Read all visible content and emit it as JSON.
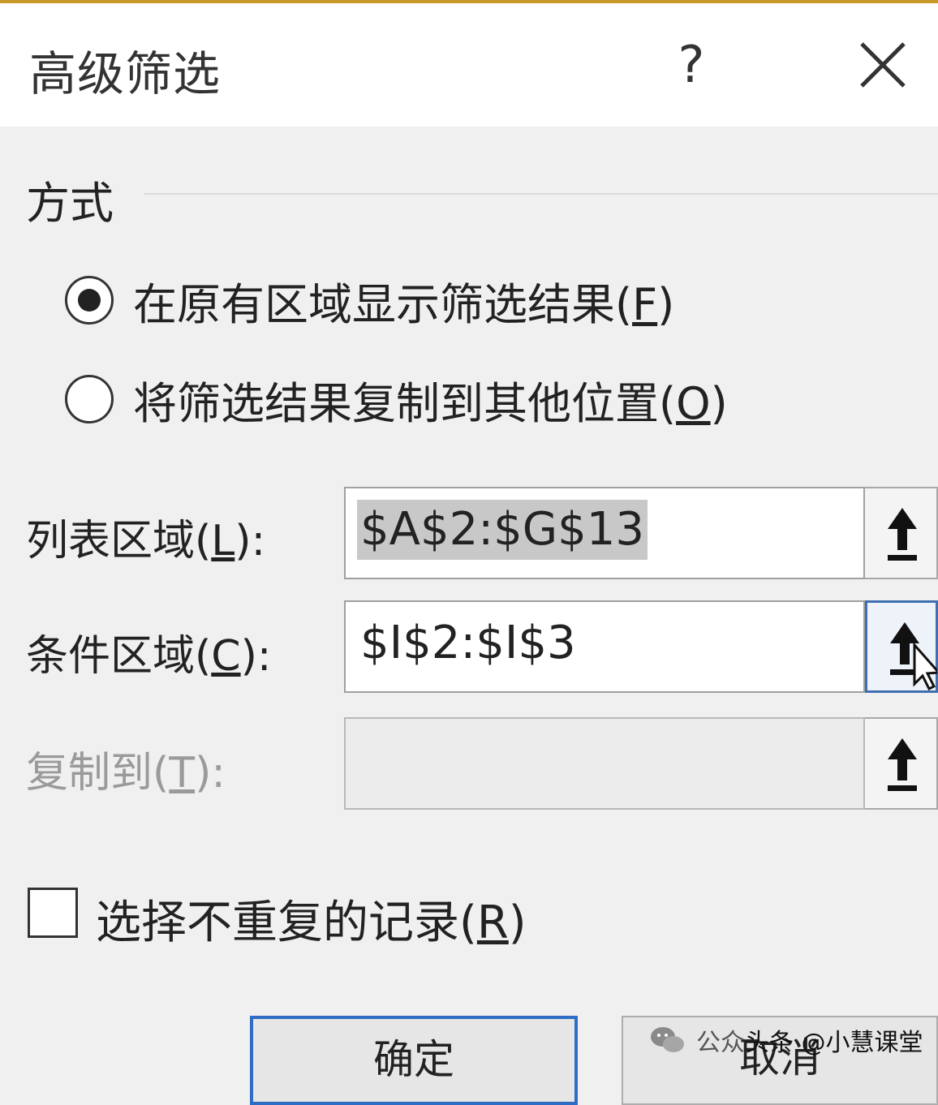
{
  "dialog": {
    "title": "高级筛选",
    "help_label": "?",
    "close_icon": "close-icon"
  },
  "mode": {
    "group_label": "方式",
    "options": [
      {
        "label_text": "在原有区域显示筛选结果(",
        "hotkey": "F",
        "label_tail": ")",
        "selected": true
      },
      {
        "label_text": "将筛选结果复制到其他位置(",
        "hotkey": "O",
        "label_tail": ")",
        "selected": false
      }
    ]
  },
  "fields": {
    "list_range": {
      "label": "列表区域(",
      "hotkey": "L",
      "tail": "):",
      "value": "$A$2:$G$13",
      "selected_text": true,
      "enabled": true
    },
    "criteria_range": {
      "label": "条件区域(",
      "hotkey": "C",
      "tail": "):",
      "value": "$I$2:$I$3",
      "enabled": true,
      "button_focused": true
    },
    "copy_to": {
      "label": "复制到(",
      "hotkey": "T",
      "tail": "):",
      "value": "",
      "enabled": false
    }
  },
  "unique_records": {
    "label": "选择不重复的记录(",
    "hotkey": "R",
    "tail": ")",
    "checked": false
  },
  "buttons": {
    "ok_label": "确定",
    "cancel_label": "取消"
  },
  "watermark": {
    "prefix": "公众",
    "account": "头条 @小慧课堂",
    "icon": "wechat-icon"
  },
  "colors": {
    "accent": "#2f6cc4",
    "title_bar": "#ffffff",
    "dialog_bg": "#f0f0f0"
  }
}
